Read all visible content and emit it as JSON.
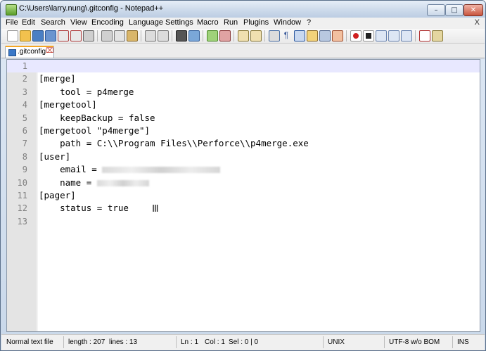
{
  "window": {
    "title": "C:\\Users\\larry.nung\\.gitconfig - Notepad++"
  },
  "menu": [
    "File",
    "Edit",
    "Search",
    "View",
    "Encoding",
    "Language",
    "Settings",
    "Macro",
    "Run",
    "Plugins",
    "Window",
    "?"
  ],
  "menu_close": "X",
  "tab": {
    "label": ".gitconfig"
  },
  "editor": {
    "lines": [
      {
        "n": "1",
        "text": ""
      },
      {
        "n": "2",
        "text": "[merge]"
      },
      {
        "n": "3",
        "text": "    tool = p4merge"
      },
      {
        "n": "4",
        "text": "[mergetool]"
      },
      {
        "n": "5",
        "text": "    keepBackup = false"
      },
      {
        "n": "6",
        "text": "[mergetool \"p4merge\"]"
      },
      {
        "n": "7",
        "text": "    path = C:\\\\Program Files\\\\Perforce\\\\p4merge.exe"
      },
      {
        "n": "8",
        "text": "[user]"
      },
      {
        "n": "9",
        "text": "    email = "
      },
      {
        "n": "10",
        "text": "    name = "
      },
      {
        "n": "11",
        "text": "[pager]"
      },
      {
        "n": "12",
        "text": "    status = true"
      },
      {
        "n": "13",
        "text": ""
      }
    ]
  },
  "status": {
    "type": "Normal text file",
    "length": "length : 207",
    "lines": "lines : 13",
    "ln": "Ln : 1",
    "col": "Col : 1",
    "sel": "Sel : 0 | 0",
    "eol": "UNIX",
    "encoding": "UTF-8 w/o BOM",
    "mode": "INS"
  },
  "colors": {
    "current_line": "#e8e8ff",
    "gutter": "#e4e4e4",
    "tab_accent": "#f5a623"
  }
}
